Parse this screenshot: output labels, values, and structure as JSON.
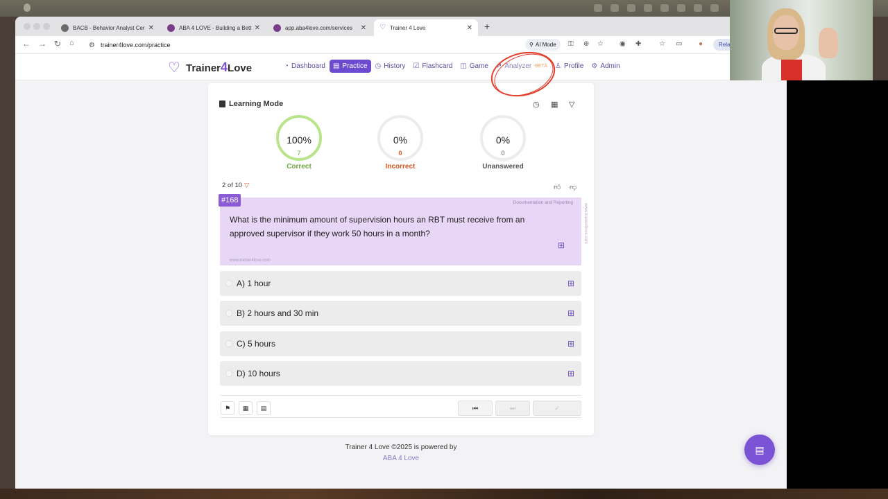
{
  "browser": {
    "tabs": [
      {
        "title": "BACB - Behavior Analyst Cer"
      },
      {
        "title": "ABA 4 LOVE - Building a Bett"
      },
      {
        "title": "app.aba4love.com/services"
      },
      {
        "title": "Trainer 4 Love"
      }
    ],
    "url": "trainer4love.com/practice",
    "ai_mode_label": "AI Mode",
    "relaunch_label": "Rela"
  },
  "site": {
    "brand_prefix": "Trainer",
    "brand_four": "4",
    "brand_suffix": "Love",
    "nav": [
      {
        "label": "Dashboard",
        "icon": "gauge-icon"
      },
      {
        "label": "Practice",
        "icon": "clipboard-icon",
        "active": true
      },
      {
        "label": "History",
        "icon": "history-icon"
      },
      {
        "label": "Flashcard",
        "icon": "flashcard-icon"
      },
      {
        "label": "Game",
        "icon": "gamepad-icon"
      },
      {
        "label": "Analyzer",
        "icon": "chart-icon",
        "badge": "BETA"
      },
      {
        "label": "Profile",
        "icon": "user-icon"
      },
      {
        "label": "Admin",
        "icon": "gear-icon"
      }
    ],
    "accent_color": "#6c4bd0"
  },
  "quiz": {
    "mode_title": "Learning Mode",
    "stats": [
      {
        "pct": "100%",
        "count": "7",
        "label": "Correct",
        "color": "#6aa83a",
        "fill": 1.0
      },
      {
        "pct": "0%",
        "count": "0",
        "label": "Incorrect",
        "color": "#d9541e",
        "fill": 0
      },
      {
        "pct": "0%",
        "count": "0",
        "label": "Unanswered",
        "color": "#555555",
        "fill": 0
      }
    ],
    "progress": "2 of 10",
    "question_number": "#168",
    "category": "Documentation and Reporting",
    "question": "What is the minimum amount of supervision hours an RBT must receive from an approved supervisor if they work 50 hours in a month?",
    "watermark": "www.trainer4love.com",
    "options": [
      {
        "label": "A) 1 hour"
      },
      {
        "label": "B) 2 hours and 30 min"
      },
      {
        "label": "C) 5 hours"
      },
      {
        "label": "D) 10 hours"
      }
    ]
  },
  "footer": {
    "powered_text": "Trainer 4 Love ©2025 is powered by",
    "powered_link": "ABA 4 Love"
  }
}
